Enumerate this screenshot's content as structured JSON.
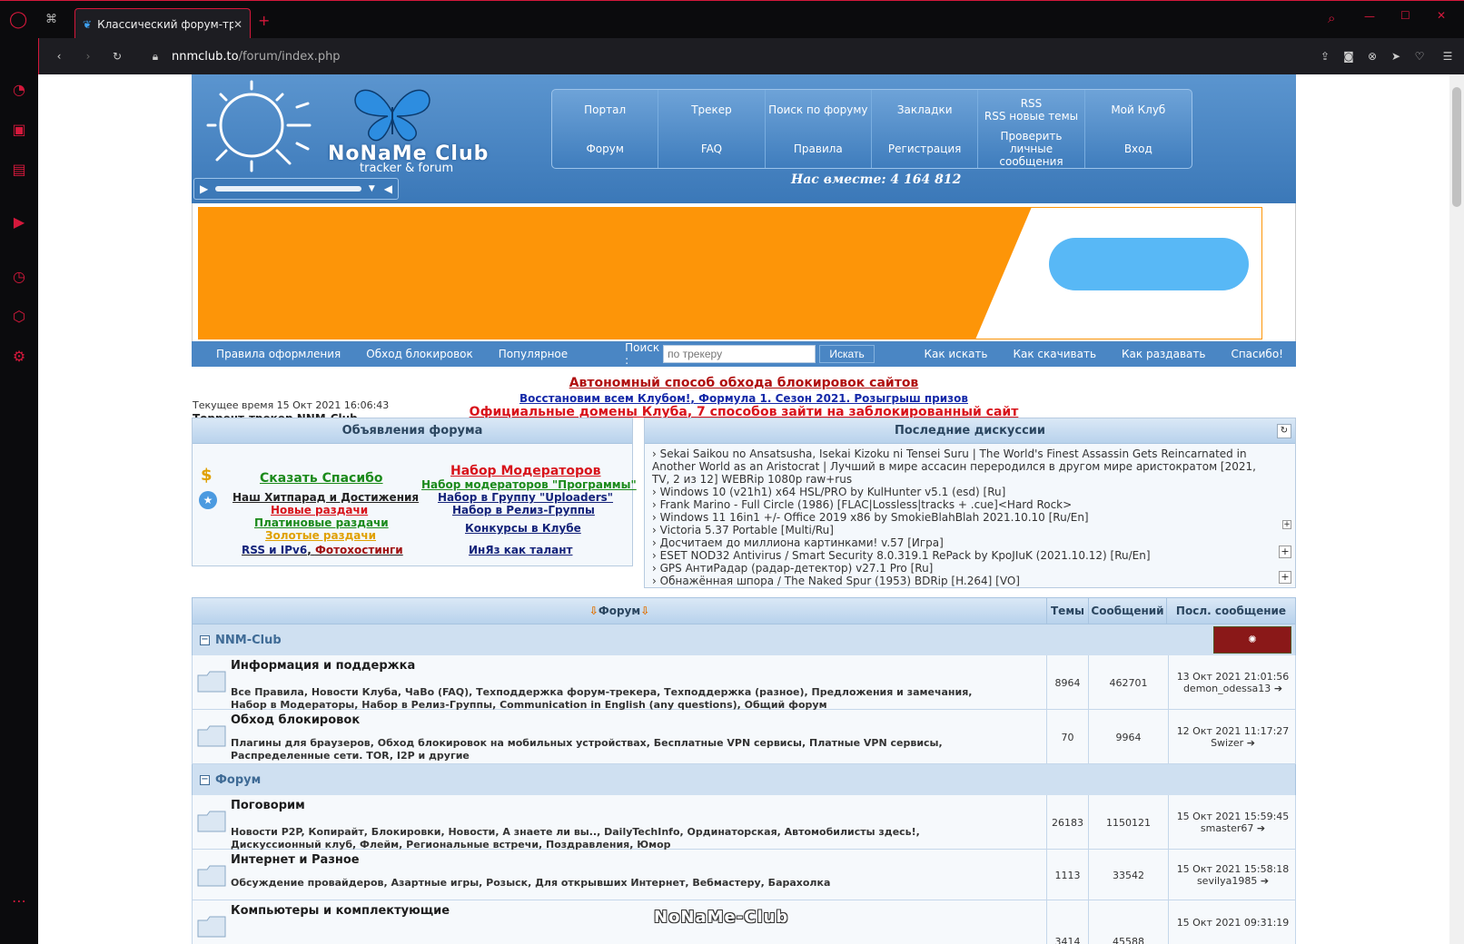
{
  "browser": {
    "tab_title": "Классический форум-трек",
    "url_domain": "nnmclub.to",
    "url_path": "/forum/index.php"
  },
  "header": {
    "logo_text": "NoNaMe Club",
    "logo_sub": "tracker & forum",
    "together": "Нас вместе: 4 164 812",
    "nav": [
      [
        "Портал",
        "Трекер",
        "Поиск по форуму",
        "Закладки",
        "RSS\nRSS новые темы",
        "Мой Клуб"
      ],
      [
        "Форум",
        "FAQ",
        "Правила",
        "Регистрация",
        "Проверить личные\nсообщения",
        "Вход"
      ]
    ]
  },
  "subnav": {
    "links_left": [
      "Правила оформления",
      "Обход блокировок",
      "Популярное"
    ],
    "search_label": "Поиск :",
    "search_placeholder": "по трекеру",
    "search_button": "Искать",
    "links_right": [
      "Как искать",
      "Как скачивать",
      "Как раздавать",
      "Спасибо!"
    ]
  },
  "notices": {
    "line1": "Автономный способ обхода блокировок сайтов",
    "line2a": "Восстановим всем Клубом!",
    "line2b": "Формула 1. Сезон 2021. Розыгрыш призов",
    "line3a": "Официальные домены Клуба",
    "line3b": "7 способов зайти на заблокированный сайт",
    "current_time": "Текущее время 15 Окт 2021 16:06:43",
    "site_name": "Торрент-трекер NNM-Club"
  },
  "announce": {
    "title": "Объявления форума",
    "links": {
      "thanks": "Сказать Спасибо",
      "hitparade": "Наш Хитпарад и Достижения",
      "new": "Новые раздачи",
      "platinum": "Платиновые раздачи",
      "gold": "Золотые раздачи",
      "rss": "RSS и IPv6",
      "comma": ",",
      "photo": "Фотохостинги",
      "moderators": "Набор Модераторов",
      "mod_programs": "Набор модераторов \"Программы\"",
      "uploaders": "Набор в Группу \"Uploaders\"",
      "release": "Набор в Релиз-Группы",
      "contests": "Конкурсы в Клубе",
      "inyaz": "ИнЯз как талант"
    },
    "colors": {
      "green": "#1b8a1b",
      "red": "#d8131b",
      "navy": "#14237a",
      "gold": "#e0a000",
      "maroon": "#a01010"
    }
  },
  "discuss": {
    "title": "Последние дискуссии",
    "items": [
      "Sekai Saikou no Ansatsusha, Isekai Kizoku ni Tensei Suru | The World's Finest Assassin Gets Reincarnated in Another World as an Aristocrat | Лучший в мире ассасин переродился в другом мире аристократом [2021, TV, 2 из 12] WEBRip 1080p raw+rus",
      "Windows 10 (v21h1) x64 HSL/PRO by KulHunter v5.1 (esd) [Ru]",
      "Frank Marino - Full Circle (1986) [FLAC|Lossless|tracks + .cue]<Hard Rock>",
      "Windows 11 16in1 +/- Office 2019 x86 by SmokieBlahBlah 2021.10.10 [Ru/En]",
      "Victoria 5.37 Portable [Multi/Ru]",
      "Досчитаем до миллиона картинками! v.57 [Игра]",
      "ESET NOD32 Antivirus / Smart Security 8.0.319.1 RePack by KpoJIuK (2021.10.12) [Ru/En]",
      "GPS АнтиРадар (радар-детектор) v27.1 Pro [Ru]",
      "Обнажённая шпора / The Naked Spur (1953) BDRip [H.264] [VO]"
    ]
  },
  "forum": {
    "col_forum": "Форум",
    "col_topics": "Темы",
    "col_posts": "Сообщений",
    "col_last": "Посл. сообщение",
    "categories": [
      {
        "name": "NNM-Club",
        "rows": [
          {
            "title": "Информация и поддержка",
            "sub1": "Все Правила, Новости Клуба, ЧаВо (FAQ), Техподдержка форум-трекера, Техподдержка (разное), Предложения и замечания,",
            "sub2": "Набор в Модераторы, Набор в Релиз-Группы, Communication in English (any questions), Общий форум",
            "topics": "8964",
            "posts": "462701",
            "last_date": "13 Окт 2021 21:01:56",
            "last_user": "demon_odessa13"
          },
          {
            "title": "Обход блокировок",
            "sub1": "Плагины для браузеров, Обход блокировок на мобильных устройствах, Бесплатные VPN сервисы, Платные VPN сервисы,",
            "sub2": "Распределенные сети. TOR, I2P и другие",
            "topics": "70",
            "posts": "9964",
            "last_date": "12 Окт 2021 11:17:27",
            "last_user": "Swizer"
          }
        ]
      },
      {
        "name": "Форум",
        "rows": [
          {
            "title": "Поговорим",
            "sub1": "Новости P2P, Копирайт, Блокировки, Новости, А знаете ли вы.., DailyTechInfo, Ординаторская, Автомобилисты здесь!,",
            "sub2": "Дискуссионный клуб, Флейм, Региональные встречи, Поздравления, Юмор",
            "topics": "26183",
            "posts": "1150121",
            "last_date": "15 Окт 2021 15:59:45",
            "last_user": "smaster67"
          },
          {
            "title": "Интернет и Разное",
            "sub1": "Обсуждение провайдеров, Азартные игры, Розыск, Для открывших Интернет, Вебмастеру, Барахолка",
            "sub2": "",
            "topics": "1113",
            "posts": "33542",
            "last_date": "15 Окт 2021 15:58:18",
            "last_user": "sevilya1985"
          },
          {
            "title": "Компьютеры и комплектующие",
            "sub1": "",
            "sub2": "",
            "topics": "3414",
            "posts": "45588",
            "last_date": "15 Окт 2021 09:31:19",
            "last_user": ""
          }
        ]
      }
    ],
    "footer_logo": "NoNaMe-Club"
  }
}
